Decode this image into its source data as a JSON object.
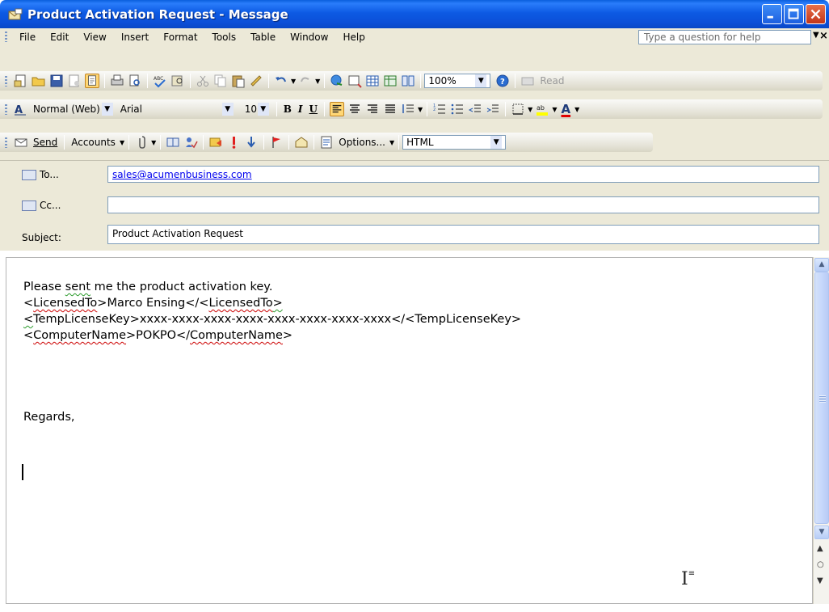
{
  "window": {
    "title": "Product Activation Request - Message",
    "accent": "#0b4fd8"
  },
  "menu": {
    "items": [
      "File",
      "Edit",
      "View",
      "Insert",
      "Format",
      "Tools",
      "Table",
      "Window",
      "Help"
    ],
    "help_placeholder": "Type a question for help"
  },
  "standard_toolbar": {
    "zoom": "100%",
    "read_label": "Read"
  },
  "format_toolbar": {
    "style": "Normal (Web)",
    "font": "Arial",
    "size": "10",
    "bold_label": "B",
    "italic_label": "I",
    "underline_label": "U",
    "font_color_label": "A"
  },
  "email_toolbar": {
    "send_label": "Send",
    "accounts_label": "Accounts",
    "options_label": "Options...",
    "format": "HTML"
  },
  "header": {
    "to_label": "To...",
    "to_value": "sales@acumenbusiness.com",
    "cc_label": "Cc...",
    "cc_value": "",
    "subject_label": "Subject:",
    "subject_value": "Product Activation Request"
  },
  "body": {
    "line1_a": "Please ",
    "line1_b": "sent",
    "line1_c": " me the product activation key.",
    "line2_a": "<",
    "line2_b": "LicensedTo",
    "line2_c": ">Marco Ensing</<",
    "line2_d": "LicensedTo",
    "line2_e": ">",
    "line3_a": "<",
    "line3_b": "TempLicenseKey>xxxx-xxxx-xxxx-xxxx-xxxx-xxxx-xxxx-xxxx</<TempLicenseKey>",
    "line4_a": "<",
    "line4_b": "ComputerName",
    "line4_c": ">POKPO</",
    "line4_d": "ComputerName",
    "line4_e": ">",
    "regards": "Regards,"
  }
}
